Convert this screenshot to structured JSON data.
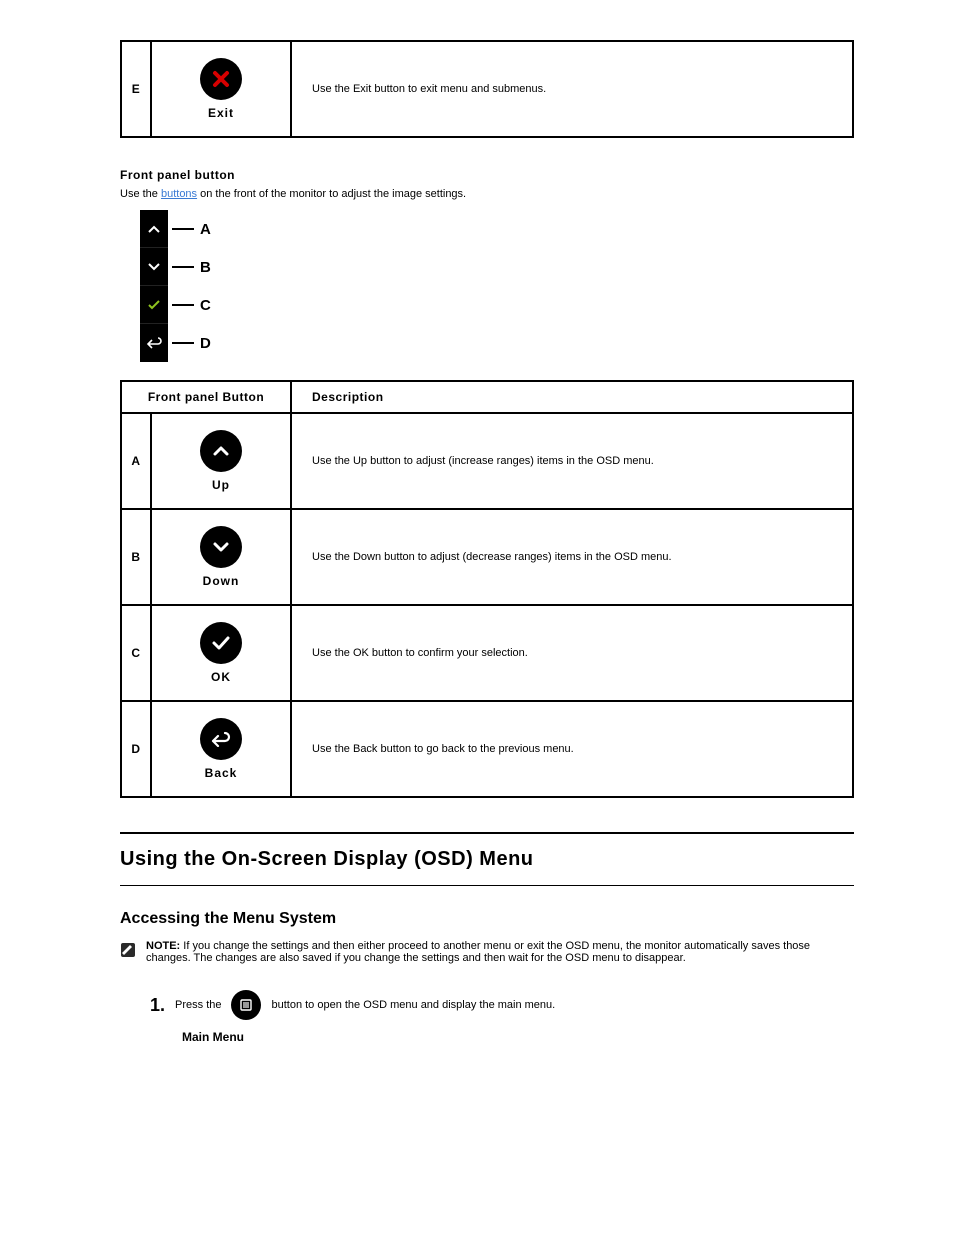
{
  "table1": {
    "idx": "E",
    "label": "Exit",
    "desc": "Use the Exit button to exit menu and submenus."
  },
  "nav_text_1": "Front panel button",
  "nav_text_2": "Use the ",
  "nav_link": "buttons",
  "nav_text_3": " on the front of the monitor to adjust the image settings.",
  "diagram": {
    "labels": [
      "A",
      "B",
      "C",
      "D"
    ]
  },
  "table2": {
    "h1": "Front panel Button",
    "h2": "Description",
    "rows": [
      {
        "idx": "A",
        "label": "Up",
        "desc": "Use the Up button to adjust (increase ranges) items in the OSD menu."
      },
      {
        "idx": "B",
        "label": "Down",
        "desc": "Use the Down button to adjust (decrease ranges) items in the OSD menu."
      },
      {
        "idx": "C",
        "label": "OK",
        "desc": "Use the OK button to confirm your selection."
      },
      {
        "idx": "D",
        "label": "Back",
        "desc": "Use the Back button to go back to the previous menu."
      }
    ]
  },
  "osd_section": "Using the On-Screen Display (OSD) Menu",
  "osd_sub": "Accessing the Menu System",
  "osd_note_label": "NOTE:",
  "osd_note": " If you change the settings and then either proceed to another menu or exit the OSD menu, the monitor automatically saves those changes. The changes are also saved if you change the settings and then wait for the OSD menu to disappear.",
  "step1_num": "1.",
  "step1_text": "Press the ",
  "step1_text2": " button to open the OSD menu and display the main menu.",
  "main_menu_label": "Main Menu"
}
